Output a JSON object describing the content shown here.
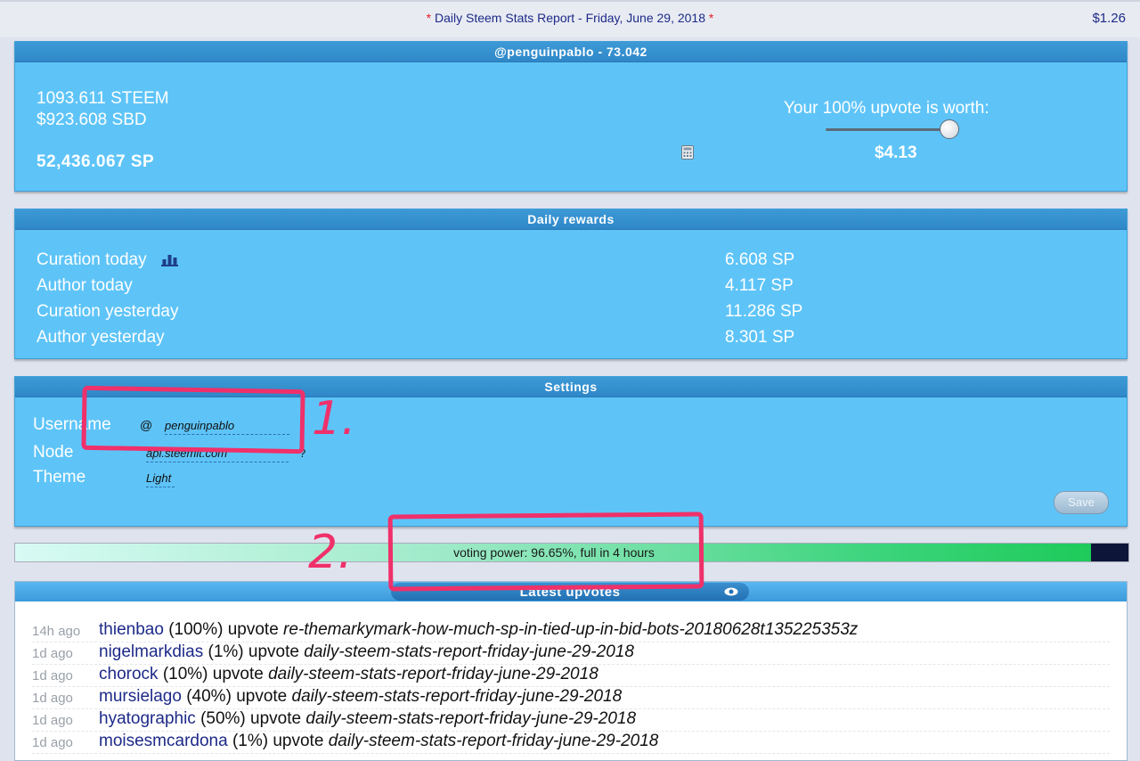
{
  "header": {
    "star_left": "*",
    "title": "Daily Steem Stats Report - Friday, June 29, 2018",
    "star_right": "*",
    "price": "$1.26"
  },
  "account": {
    "title": "@penguinpablo - 73.042",
    "steem": "1093.611 STEEM",
    "sbd": "$923.608 SBD",
    "sp": "52,436.067 SP",
    "upvote_label": "Your 100% upvote is worth:",
    "upvote_value": "$4.13",
    "upvote_slider_pct": 100
  },
  "daily_rewards": {
    "title": "Daily rewards",
    "rows": [
      {
        "label": "Curation today",
        "value": "6.608 SP"
      },
      {
        "label": "Author today",
        "value": "4.117 SP"
      },
      {
        "label": "Curation yesterday",
        "value": "11.286 SP"
      },
      {
        "label": "Author yesterday",
        "value": "8.301 SP"
      }
    ]
  },
  "settings": {
    "title": "Settings",
    "username_label": "Username",
    "at_sign": "@",
    "username_value": "penguinpablo",
    "node_label": "Node",
    "node_value": "api.steemit.com",
    "node_help": "?",
    "theme_label": "Theme",
    "theme_value": "Light",
    "save_label": "Save"
  },
  "voting_power": {
    "text": "voting power: 96.65%, full in 4 hours",
    "percent": 96.65
  },
  "latest_upvotes": {
    "title": "Latest upvotes",
    "rows": [
      {
        "ago": "14h ago",
        "user": "thienbao",
        "pct": "(100%)",
        "verb": "upvote",
        "permlink": "re-themarkymark-how-much-sp-in-tied-up-in-bid-bots-20180628t135225353z"
      },
      {
        "ago": "1d ago",
        "user": "nigelmarkdias",
        "pct": "(1%)",
        "verb": "upvote",
        "permlink": "daily-steem-stats-report-friday-june-29-2018"
      },
      {
        "ago": "1d ago",
        "user": "chorock",
        "pct": "(10%)",
        "verb": "upvote",
        "permlink": "daily-steem-stats-report-friday-june-29-2018"
      },
      {
        "ago": "1d ago",
        "user": "mursielago",
        "pct": "(40%)",
        "verb": "upvote",
        "permlink": "daily-steem-stats-report-friday-june-29-2018"
      },
      {
        "ago": "1d ago",
        "user": "hyatographic",
        "pct": "(50%)",
        "verb": "upvote",
        "permlink": "daily-steem-stats-report-friday-june-29-2018"
      },
      {
        "ago": "1d ago",
        "user": "moisesmcardona",
        "pct": "(1%)",
        "verb": "upvote",
        "permlink": "daily-steem-stats-report-friday-june-29-2018"
      }
    ]
  },
  "annotations": {
    "label_1": "1.",
    "label_2": "2.",
    "color": "#f0306a"
  }
}
